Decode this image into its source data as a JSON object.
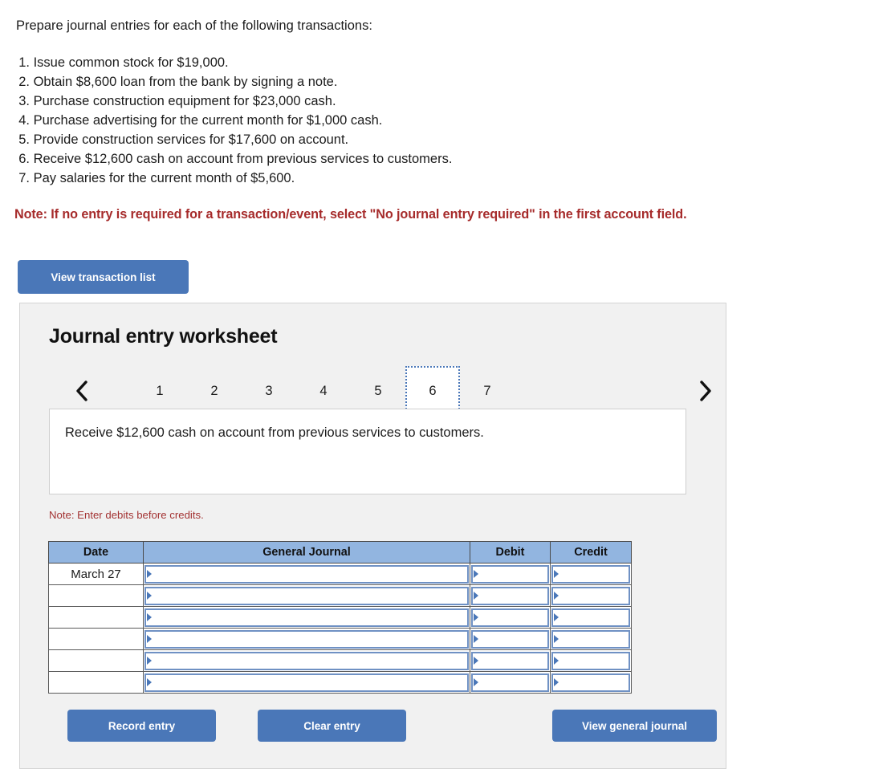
{
  "prompt": "Prepare journal entries for each of the following transactions:",
  "transactions": [
    {
      "num": "1.",
      "text": "Issue common stock for $19,000."
    },
    {
      "num": "2.",
      "text": "Obtain $8,600 loan from the bank by signing a note."
    },
    {
      "num": "3.",
      "text": "Purchase construction equipment for $23,000 cash."
    },
    {
      "num": "4.",
      "text": "Purchase advertising for the current month for $1,000 cash."
    },
    {
      "num": "5.",
      "text": "Provide construction services for $17,600 on account."
    },
    {
      "num": "6.",
      "text": "Receive $12,600 cash on account from previous services to customers."
    },
    {
      "num": "7.",
      "text": "Pay salaries for the current month of $5,600."
    }
  ],
  "red_note": "Note: If no entry is required for a transaction/event, select \"No journal entry required\" in the first account field.",
  "view_transaction_list_label": "View transaction list",
  "worksheet": {
    "title": "Journal entry worksheet",
    "pager": {
      "prev_icon": "chevron-left-icon",
      "next_icon": "chevron-right-icon",
      "tabs": [
        "1",
        "2",
        "3",
        "4",
        "5",
        "6",
        "7"
      ],
      "active_tab": "6"
    },
    "description": "Receive $12,600 cash on account from previous services to customers.",
    "note": "Note: Enter debits before credits.",
    "table": {
      "headers": [
        "Date",
        "General Journal",
        "Debit",
        "Credit"
      ],
      "rows": [
        {
          "date": "March 27",
          "general_journal": "",
          "debit": "",
          "credit": ""
        },
        {
          "date": "",
          "general_journal": "",
          "debit": "",
          "credit": ""
        },
        {
          "date": "",
          "general_journal": "",
          "debit": "",
          "credit": ""
        },
        {
          "date": "",
          "general_journal": "",
          "debit": "",
          "credit": ""
        },
        {
          "date": "",
          "general_journal": "",
          "debit": "",
          "credit": ""
        },
        {
          "date": "",
          "general_journal": "",
          "debit": "",
          "credit": ""
        }
      ]
    },
    "buttons": {
      "record": "Record entry",
      "clear": "Clear entry",
      "view_general_journal": "View general journal"
    }
  },
  "colors": {
    "button_blue": "#4a77b8",
    "table_header_blue": "#92b5e0",
    "field_border_blue": "#6f91c4",
    "note_red": "#a62b2b",
    "small_note_red": "#a33232",
    "panel_bg": "#f1f1f1"
  }
}
